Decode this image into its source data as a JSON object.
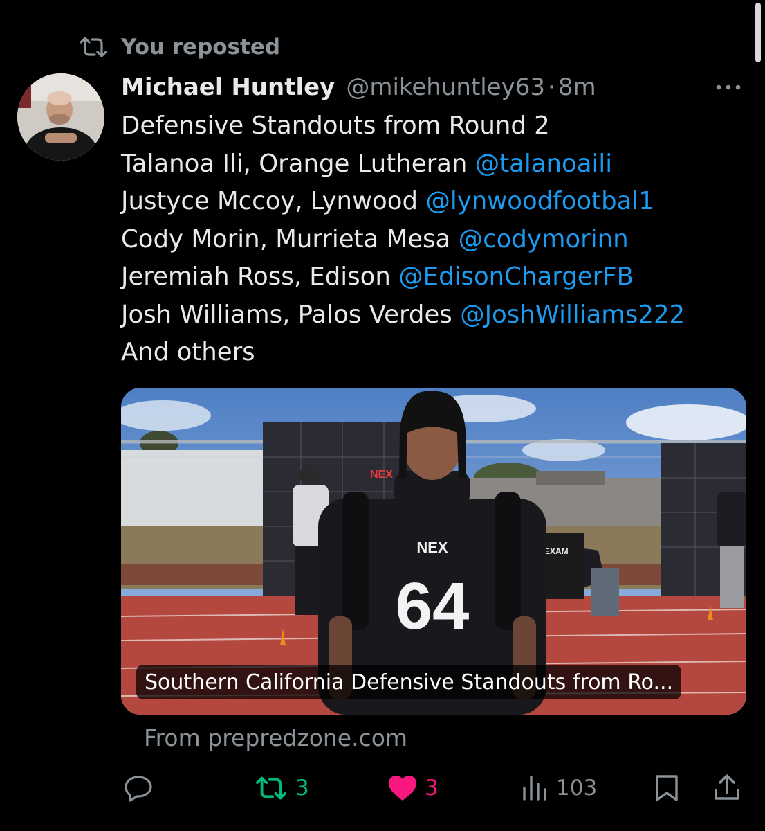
{
  "repost": {
    "label": "You reposted",
    "icon": "repost-icon"
  },
  "author": {
    "name": "Michael Huntley",
    "handle": "@mikehuntley63",
    "separator": "·",
    "time": "8m"
  },
  "post": {
    "lines": [
      {
        "text": "Defensive Standouts from Round 2",
        "mention": ""
      },
      {
        "text": "Talanoa Ili, Orange Lutheran ",
        "mention": "@talanoaili"
      },
      {
        "text": "Justyce Mccoy, Lynwood ",
        "mention": "@lynwoodfootbal1"
      },
      {
        "text": "Cody Morin, Murrieta Mesa ",
        "mention": "@codymorinn"
      },
      {
        "text": "Jeremiah Ross, Edison ",
        "mention": "@EdisonChargerFB"
      },
      {
        "text": "Josh Williams, Palos Verdes ",
        "mention": "@JoshWilliams222"
      },
      {
        "text": "And others",
        "mention": ""
      }
    ]
  },
  "card": {
    "title": "Southern California Defensive Standouts from Ro...",
    "source": "From prepredzone.com",
    "photo": {
      "jersey_number": "64",
      "jersey_brand": "NEX",
      "sign_text": "EXAM",
      "wall_text": "NEX"
    }
  },
  "actions": {
    "reply": {
      "icon": "reply-icon",
      "count": ""
    },
    "repost": {
      "icon": "repost-icon",
      "count": "3",
      "color": "#00ba7c"
    },
    "like": {
      "icon": "heart-icon",
      "count": "3",
      "color": "#f91880"
    },
    "views": {
      "icon": "views-icon",
      "count": "103"
    },
    "bookmark": {
      "icon": "bookmark-icon"
    },
    "share": {
      "icon": "share-icon"
    }
  },
  "colors": {
    "background": "#000000",
    "text": "#e7e9ea",
    "muted": "#8b9298",
    "link": "#1d9bf0"
  }
}
